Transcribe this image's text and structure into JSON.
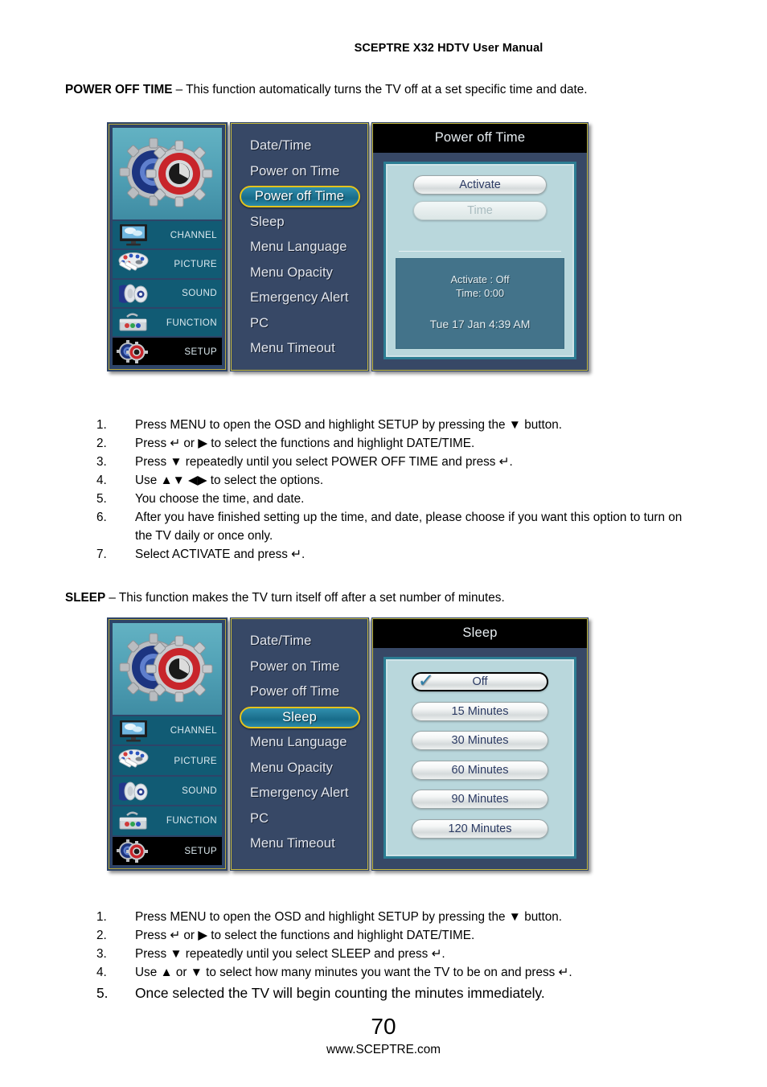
{
  "header": {
    "title": "SCEPTRE X32 HDTV User Manual"
  },
  "sections": [
    {
      "heading": "POWER OFF TIME",
      "intro_rest": " – This function automatically turns the TV off at a set specific time and date.",
      "steps": [
        {
          "num": "1.",
          "text": "Press MENU to open the OSD and highlight SETUP by pressing the ▼ button."
        },
        {
          "num": "2.",
          "text": "Press ↵ or ▶ to select the functions and highlight DATE/TIME."
        },
        {
          "num": "3.",
          "text": "Press ▼ repeatedly until you select POWER OFF TIME and press ↵."
        },
        {
          "num": "4.",
          "text": "Use ▲▼ ◀▶ to select the options."
        },
        {
          "num": "5.",
          "text": "You choose the time, and date."
        },
        {
          "num": "6.",
          "text": "After you have finished setting up the time, and date, please choose if you want this option to turn on the TV daily or once only."
        },
        {
          "num": "7.",
          "text": "Select ACTIVATE and press ↵."
        }
      ]
    },
    {
      "heading": "SLEEP",
      "intro_rest": " – This function makes the TV turn itself off after a set number of minutes.",
      "steps": [
        {
          "num": "1.",
          "text": "Press MENU to open the OSD and highlight SETUP by pressing the ▼ button."
        },
        {
          "num": "2.",
          "text": "Press ↵ or ▶ to select the functions and highlight DATE/TIME."
        },
        {
          "num": "3.",
          "text": "Press ▼ repeatedly until you select SLEEP and press ↵."
        },
        {
          "num": "4.",
          "text": "Use ▲ or ▼ to select how many minutes you want the TV to be on and press ↵."
        },
        {
          "num": "5.",
          "text": "Once selected the TV will begin counting the minutes immediately."
        }
      ]
    }
  ],
  "osd_sidebar": {
    "items": [
      {
        "label": "CHANNEL",
        "icon": "tv-monitor-icon",
        "selected": false
      },
      {
        "label": "PICTURE",
        "icon": "paint-palette-icon",
        "selected": false
      },
      {
        "label": "SOUND",
        "icon": "speakers-icon",
        "selected": false
      },
      {
        "label": "FUNCTION",
        "icon": "toolbox-icon",
        "selected": false
      },
      {
        "label": "SETUP",
        "icon": "gears-icon",
        "selected": true
      }
    ],
    "logo_icon": "gears-logo-icon"
  },
  "osd_menu": {
    "items": [
      "Date/Time",
      "Power on Time",
      "Power off Time",
      "Sleep",
      "Menu Language",
      "Menu Opacity",
      "Emergency Alert",
      "PC",
      "Menu Timeout"
    ],
    "highlighted_1": "Power off Time",
    "highlighted_2": "Sleep"
  },
  "osd_power_off": {
    "title": "Power off Time",
    "buttons": [
      {
        "label": "Activate",
        "state": "enabled"
      },
      {
        "label": "Time",
        "state": "disabled"
      }
    ],
    "info": {
      "activate_line": "Activate : Off",
      "time_line": "Time: 0:00",
      "clock_line": "Tue 17 Jan 4:39 AM"
    }
  },
  "osd_sleep": {
    "title": "Sleep",
    "options": [
      {
        "label": "Off",
        "checked": true
      },
      {
        "label": "15 Minutes",
        "checked": false
      },
      {
        "label": "30 Minutes",
        "checked": false
      },
      {
        "label": "60 Minutes",
        "checked": false
      },
      {
        "label": "90 Minutes",
        "checked": false
      },
      {
        "label": "120 Minutes",
        "checked": false
      }
    ],
    "check_glyph": "✓"
  },
  "footer": {
    "page_number": "70",
    "url": "www.SCEPTRE.com"
  },
  "colors": {
    "osd_panel_bg": "#374866",
    "osd_sidebar_item": "#115b74",
    "osd_highlight_border": "#e4c31d",
    "osd_panel_light": "#b9d7dc",
    "osd_info_box": "#43738a",
    "osd_title_bar": "#000000"
  }
}
